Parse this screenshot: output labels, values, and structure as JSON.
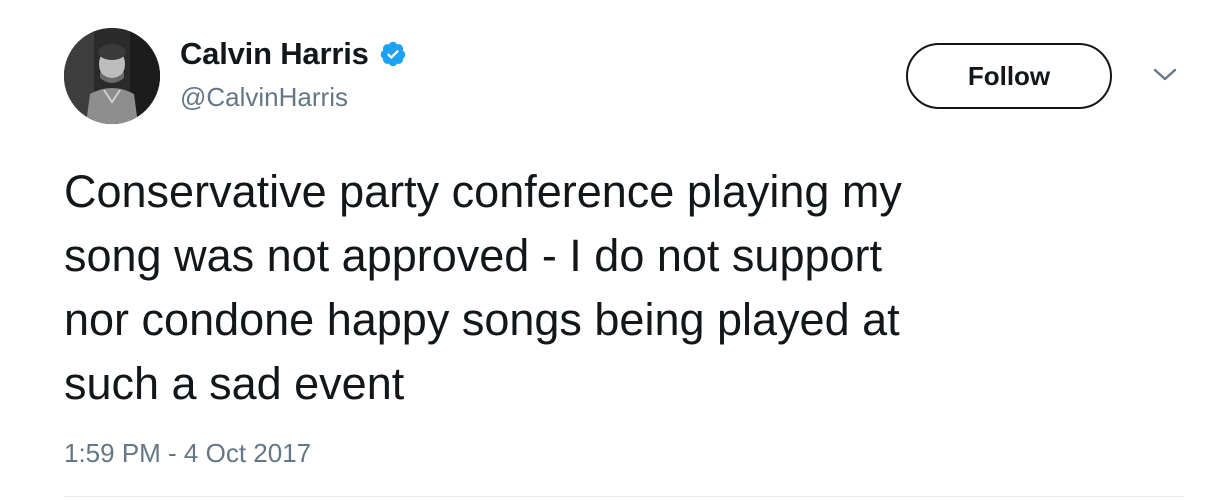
{
  "author": {
    "display_name": "Calvin Harris",
    "handle": "@CalvinHarris",
    "verified_icon": "verified-badge-icon",
    "avatar_icon": "profile-photo"
  },
  "actions": {
    "follow_label": "Follow",
    "menu_icon": "chevron-down-icon"
  },
  "tweet": {
    "text_lines": [
      "Conservative party conference playing my",
      "song was not approved - I do not support",
      "nor condone happy songs being played at",
      "such a sad event"
    ],
    "timestamp": "1:59 PM - 4 Oct 2017"
  },
  "colors": {
    "text_primary": "#14171a",
    "text_secondary": "#657786",
    "verified_blue": "#1da1f2",
    "divider": "#e6ecf0"
  }
}
